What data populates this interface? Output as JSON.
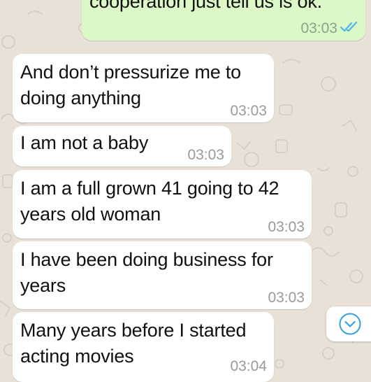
{
  "messages": [
    {
      "direction": "outgoing",
      "text": "cooperation just tell us is ok.",
      "time": "03:03",
      "status": "read-double-tick-icon"
    },
    {
      "direction": "incoming",
      "lines": [
        "And don’t pressurize me to",
        "doing anything"
      ],
      "time": "03:03"
    },
    {
      "direction": "incoming",
      "lines": [
        "I am not a baby"
      ],
      "time": "03:03"
    },
    {
      "direction": "incoming",
      "lines": [
        "I am a full grown 41 going to 42",
        "years old woman"
      ],
      "time": "03:03"
    },
    {
      "direction": "incoming",
      "lines": [
        "I have been doing business for",
        "years"
      ],
      "time": "03:03"
    },
    {
      "direction": "incoming",
      "lines": [
        "Many years before I started",
        "acting movies"
      ],
      "time": "03:04"
    }
  ],
  "scroll_button": {
    "icon": "chevron-down-circle-icon"
  },
  "colors": {
    "wallpaper": "#e8e1d8",
    "incoming_bubble": "#ffffff",
    "outgoing_bubble": "#dcf8c6",
    "read_ticks": "#4fb6ec",
    "timestamp": "#9a9a9a",
    "accent": "#34a3dc"
  }
}
